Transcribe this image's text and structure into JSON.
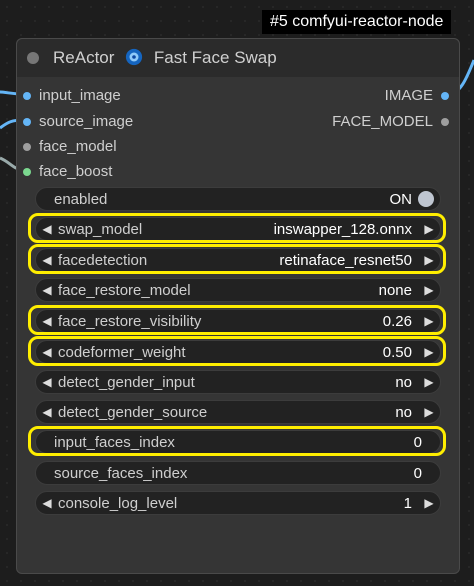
{
  "tag": "#5 comfyui-reactor-node",
  "node": {
    "title_prefix": "ReActor",
    "title_suffix": "Fast Face Swap",
    "inputs": [
      {
        "label": "input_image",
        "color": "#64b5f6"
      },
      {
        "label": "source_image",
        "color": "#64b5f6"
      },
      {
        "label": "face_model",
        "color": "#9e9e9e"
      },
      {
        "label": "face_boost",
        "color": "#7bd88f"
      }
    ],
    "outputs": [
      {
        "label": "IMAGE",
        "color": "#64b5f6"
      },
      {
        "label": "FACE_MODEL",
        "color": "#9e9e9e"
      }
    ],
    "widgets": [
      {
        "label": "enabled",
        "value": "ON"
      },
      {
        "label": "swap_model",
        "value": "inswapper_128.onnx"
      },
      {
        "label": "facedetection",
        "value": "retinaface_resnet50"
      },
      {
        "label": "face_restore_model",
        "value": "none"
      },
      {
        "label": "face_restore_visibility",
        "value": "0.26"
      },
      {
        "label": "codeformer_weight",
        "value": "0.50"
      },
      {
        "label": "detect_gender_input",
        "value": "no"
      },
      {
        "label": "detect_gender_source",
        "value": "no"
      },
      {
        "label": "input_faces_index",
        "value": "0"
      },
      {
        "label": "source_faces_index",
        "value": "0"
      },
      {
        "label": "console_log_level",
        "value": "1"
      }
    ]
  },
  "colors": {
    "highlight": "#ffee00",
    "image_link": "#64b5f6",
    "face_boost_link": "#7bd88f"
  }
}
